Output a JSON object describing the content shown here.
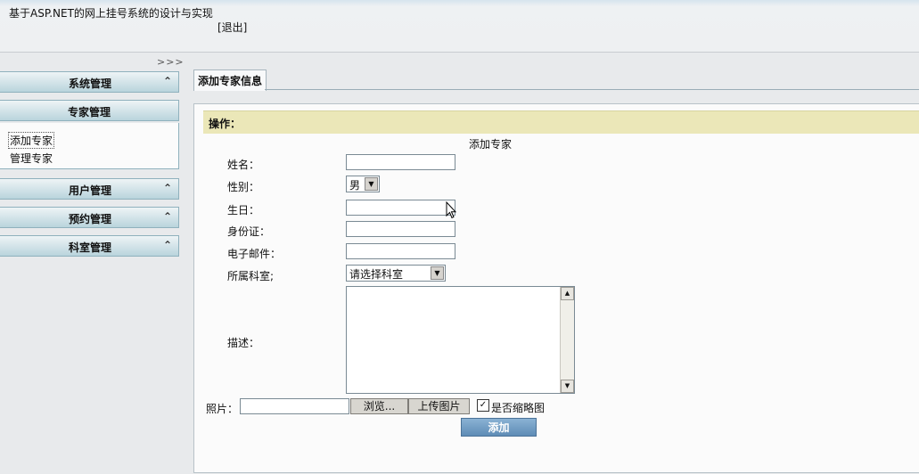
{
  "header": {
    "title": "基于ASP.NET的网上挂号系统的设计与实现",
    "logout": "[退出]"
  },
  "sidebar": {
    "toggle": ">>>",
    "sections": [
      {
        "label": "系统管理",
        "chevron": "⌃"
      },
      {
        "label": "专家管理"
      },
      {
        "label": "用户管理",
        "chevron": "⌃"
      },
      {
        "label": "预约管理",
        "chevron": "⌃"
      },
      {
        "label": "科室管理",
        "chevron": "⌃"
      }
    ],
    "expert_items": [
      "添加专家",
      "管理专家"
    ]
  },
  "main": {
    "tab": "添加专家信息",
    "operation": "操作：",
    "form_title": "添加专家",
    "fields": {
      "name": "姓名：",
      "gender": "性别：",
      "birthday": "生日：",
      "id_card": "身份证：",
      "email": "电子邮件：",
      "department": "所属科室;",
      "description": "描述：",
      "photo": "照片："
    },
    "gender_value": "男",
    "department_value": "请选择科室",
    "browse_button": "浏览...",
    "upload_button": "上传图片",
    "thumbnail_checkbox": {
      "label": "是否缩略图",
      "checked": true
    },
    "add_button": "添加"
  }
}
